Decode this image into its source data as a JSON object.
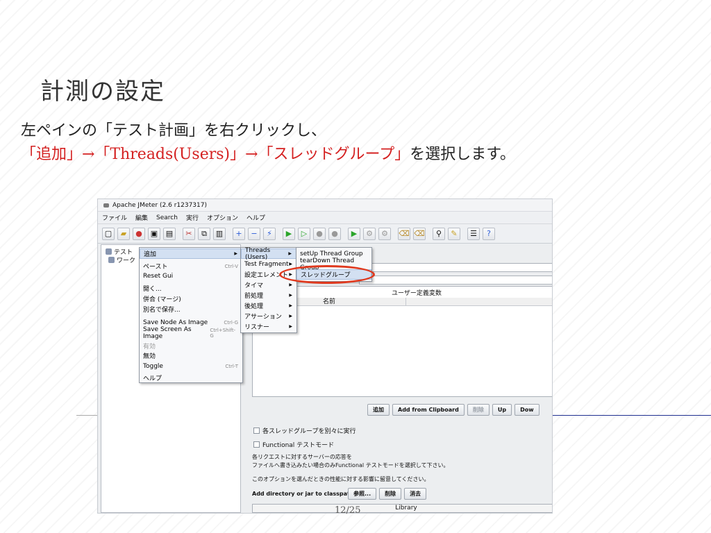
{
  "slide": {
    "title": "計測の設定",
    "line1": "左ペインの「テスト計画」を右クリックし、",
    "line2_red": "「追加」→「Threads(Users)」→「スレッドグループ」",
    "line2_black": "を選択します。",
    "page": "12/25"
  },
  "app": {
    "window_title": "Apache JMeter (2.6 r1237317)",
    "menu": [
      "ファイル",
      "編集",
      "Search",
      "実行",
      "オプション",
      "ヘルプ"
    ],
    "toolbar_icons": [
      "new-icon",
      "open-icon",
      "open-recent-icon",
      "save-icon",
      "save-as-icon",
      "cut-icon",
      "copy-icon",
      "paste-icon",
      "expand-icon",
      "collapse-icon",
      "toggle-icon",
      "start-icon",
      "start-no-pause-icon",
      "stop-icon",
      "shutdown-icon",
      "remote-start-icon",
      "remote-stop-icon",
      "remote-shutdown-icon",
      "clear-icon",
      "clear-all-icon",
      "search-icon",
      "reset-search-icon",
      "function-helper-icon",
      "help-icon"
    ],
    "tree": {
      "root": "テスト",
      "child": "ワーク"
    },
    "context_menu": [
      {
        "label": "追加",
        "shortcut": "",
        "submenu": true,
        "selected": true
      },
      {
        "label": "ペースト",
        "shortcut": "Ctrl-V"
      },
      {
        "label": "Reset Gui",
        "shortcut": ""
      },
      {
        "label": "開く...",
        "shortcut": ""
      },
      {
        "label": "併合 (マージ)",
        "shortcut": ""
      },
      {
        "label": "別名で保存...",
        "shortcut": ""
      },
      {
        "label": "Save Node As Image",
        "shortcut": "Ctrl-G"
      },
      {
        "label": "Save Screen As Image",
        "shortcut": "Ctrl+Shift-G"
      },
      {
        "label": "有効",
        "shortcut": "",
        "disabled": true
      },
      {
        "label": "無効",
        "shortcut": ""
      },
      {
        "label": "Toggle",
        "shortcut": "Ctrl-T"
      },
      {
        "label": "ヘルプ",
        "shortcut": ""
      }
    ],
    "submenu_add": [
      {
        "label": "Threads (Users)",
        "selected": true
      },
      {
        "label": "Test Fragment"
      },
      {
        "label": "設定エレメント"
      },
      {
        "label": "タイマ"
      },
      {
        "label": "前処理"
      },
      {
        "label": "後処理"
      },
      {
        "label": "アサーション"
      },
      {
        "label": "リスナー"
      }
    ],
    "submenu_threads": [
      {
        "label": "setUp Thread Group"
      },
      {
        "label": "tearDown Thread Group"
      },
      {
        "label": "スレッドグループ",
        "selected": true
      }
    ],
    "panel": {
      "table_caption": "ユーザー定義変数",
      "col_name": "名前",
      "buttons": {
        "add": "追加",
        "add_clipboard": "Add from Clipboard",
        "delete": "削除",
        "up": "Up",
        "down": "Dow"
      },
      "check_serial": "各スレッドグループを別々に実行",
      "check_functional": "Functional テストモード",
      "note1": "各リクエストに対するサーバーの応答を",
      "note2": "ファイルへ書き込みたい場合のみFunctional テストモードを選択して下さい。",
      "note3": "このオプションを選んだときの性能に対する影響に留意してください。",
      "classpath_label": "Add directory or jar to classpath",
      "browse": "参照...",
      "delete_cp": "削除",
      "clear": "消去",
      "library_header": "Library"
    }
  }
}
